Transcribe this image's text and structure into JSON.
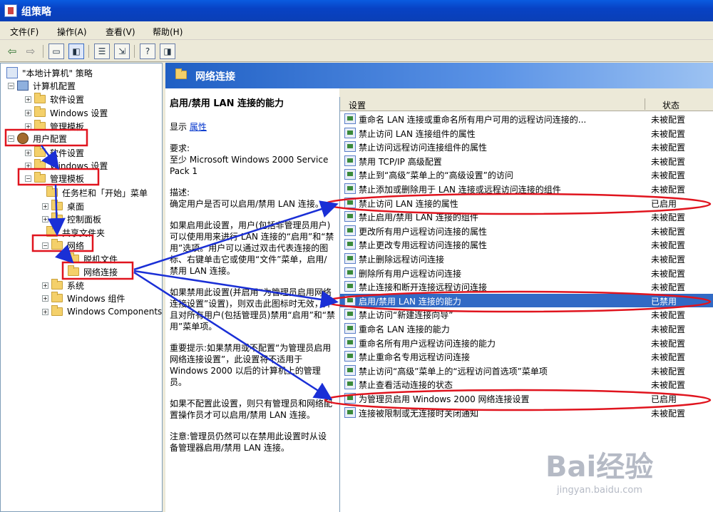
{
  "window": {
    "title": "组策略"
  },
  "menu": [
    "文件(F)",
    "操作(A)",
    "查看(V)",
    "帮助(H)"
  ],
  "toolbar": {
    "icons": [
      "back-arrow-icon",
      "forward-arrow-icon",
      "up-folder-icon",
      "show-tree-icon",
      "properties-icon",
      "export-list-icon",
      "help-icon",
      "show-pane-icon"
    ]
  },
  "tree": {
    "root": "\"本地计算机\" 策略",
    "computer_config": "计算机配置",
    "software_settings_1": "软件设置",
    "windows_settings_1": "Windows 设置",
    "admin_templates_1": "管理模板",
    "user_config": "用户配置",
    "software_settings_2": "软件设置",
    "windows_settings_2": "Windows 设置",
    "admin_templates_2": "管理模板",
    "taskbar_start": "任务栏和「开始」菜单",
    "desktop": "桌面",
    "control_panel": "控制面板",
    "shared_folders": "共享文件夹",
    "network": "网络",
    "offline_files": "脱机文件",
    "network_connections": "网络连接",
    "system": "系统",
    "windows_components_cn": "Windows 组件",
    "windows_components_en": "Windows Components"
  },
  "banner": {
    "title": "网络连接"
  },
  "description": {
    "title": "启用/禁用 LAN 连接的能力",
    "show_prefix": "显示",
    "properties_link": "属性",
    "requirements_label": "要求:",
    "requirements_text": "至少 Microsoft Windows 2000 Service Pack 1",
    "desc_label": "描述:",
    "desc_text": "确定用户是否可以启用/禁用 LAN 连接。",
    "p1": "如果启用此设置，用户(包括非管理员用户)可以使用用来进行 LAN 连接的“启用”和“禁用”选项。用户可以通过双击代表连接的图标、右键单击它或使用“文件”菜单，启用/禁用 LAN 连接。",
    "p2": "如果禁用此设置(并启用“为管理员启用网络连接设置”设置)，则双击此图标时无效，并且对所有用户(包括管理员)禁用“启用”和“禁用”菜单项。",
    "p3": "重要提示:如果禁用或不配置“为管理员启用网络连接设置”，此设置将不适用于 Windows 2000 以后的计算机上的管理员。",
    "p4": "如果不配置此设置，则只有管理员和网络配置操作员才可以启用/禁用 LAN 连接。",
    "p5": "注意:管理员仍然可以在禁用此设置时从设备管理器启用/禁用 LAN 连接。"
  },
  "list": {
    "col_setting": "设置",
    "col_state": "状态",
    "selected_index": 13,
    "rows": [
      {
        "label": "重命名 LAN 连接或重命名所有用户可用的远程访问连接的...",
        "state": "未被配置"
      },
      {
        "label": "禁止访问 LAN 连接组件的属性",
        "state": "未被配置"
      },
      {
        "label": "禁止访问远程访问连接组件的属性",
        "state": "未被配置"
      },
      {
        "label": "禁用 TCP/IP 高级配置",
        "state": "未被配置"
      },
      {
        "label": "禁止到“高级”菜单上的“高级设置”的访问",
        "state": "未被配置"
      },
      {
        "label": "禁止添加或删除用于 LAN 连接或远程访问连接的组件",
        "state": "未被配置"
      },
      {
        "label": "禁止访问 LAN 连接的属性",
        "state": "已启用"
      },
      {
        "label": "禁止启用/禁用 LAN 连接的组件",
        "state": "未被配置"
      },
      {
        "label": "更改所有用户远程访问连接的属性",
        "state": "未被配置"
      },
      {
        "label": "禁止更改专用远程访问连接的属性",
        "state": "未被配置"
      },
      {
        "label": "禁止删除远程访问连接",
        "state": "未被配置"
      },
      {
        "label": "删除所有用户远程访问连接",
        "state": "未被配置"
      },
      {
        "label": "禁止连接和断开连接远程访问连接",
        "state": "未被配置"
      },
      {
        "label": "启用/禁用 LAN 连接的能力",
        "state": "已禁用"
      },
      {
        "label": "禁止访问“新建连接向导”",
        "state": "未被配置"
      },
      {
        "label": "重命名 LAN 连接的能力",
        "state": "未被配置"
      },
      {
        "label": "重命名所有用户远程访问连接的能力",
        "state": "未被配置"
      },
      {
        "label": "禁止重命名专用远程访问连接",
        "state": "未被配置"
      },
      {
        "label": "禁止访问“高级”菜单上的“远程访问首选项”菜单项",
        "state": "未被配置"
      },
      {
        "label": "禁止查看活动连接的状态",
        "state": "未被配置"
      },
      {
        "label": "为管理员启用 Windows 2000 网络连接设置",
        "state": "已启用"
      },
      {
        "label": "连接被限制或无连接时关闭通知",
        "state": "未被配置"
      }
    ]
  },
  "annotations": {
    "color": "#e0141e",
    "arrow_color": "#1a2fd6"
  },
  "watermark": {
    "brand": "Bai经验",
    "url": "jingyan.baidu.com"
  }
}
